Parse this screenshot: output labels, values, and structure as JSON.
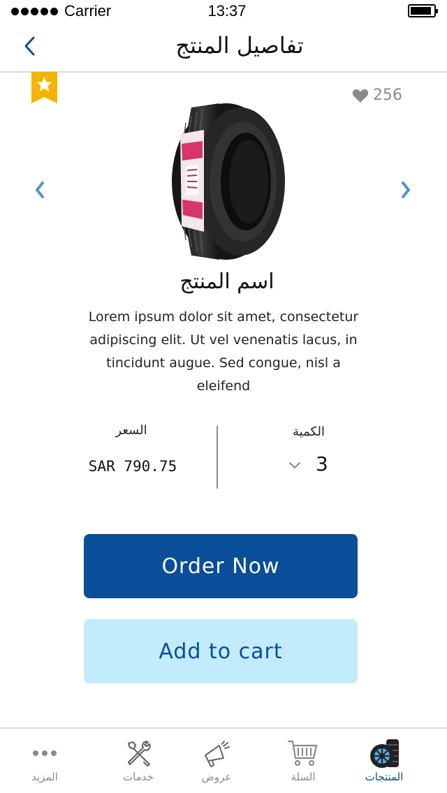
{
  "status_bar": {
    "carrier": "Carrier",
    "time": "13:37",
    "battery_level": 0.9
  },
  "nav": {
    "title": "تفاصيل المنتج",
    "back_icon": "chevron-left-icon"
  },
  "product": {
    "badge_icon": "star-ribbon-icon",
    "likes_icon": "heart-icon",
    "likes_count": "256",
    "image": "tire-image",
    "name": "اسم المنتج",
    "description": "Lorem ipsum dolor sit amet, consectetur adipiscing elit. Ut vel venenatis lacus, in tincidunt augue. Sed congue, nisl a eleifend",
    "price_label": "السعر",
    "price_value": "SAR  790.75",
    "quantity_label": "الكمية",
    "quantity_value": "3"
  },
  "actions": {
    "order_now": "Order Now",
    "add_to_cart": "Add to cart"
  },
  "colors": {
    "primary": "#0a4d99",
    "secondary_button": "#c2ecfc",
    "badge": "#f5b400",
    "arrow": "#5b8fc9"
  },
  "tabs": [
    {
      "label": "المزيد",
      "icon": "more-dots-icon"
    },
    {
      "label": "خدمات",
      "icon": "tools-icon"
    },
    {
      "label": "عروض",
      "icon": "megaphone-icon"
    },
    {
      "label": "السلة",
      "icon": "cart-icon"
    },
    {
      "label": "المنتجات",
      "icon": "tires-icon",
      "active": true
    }
  ]
}
